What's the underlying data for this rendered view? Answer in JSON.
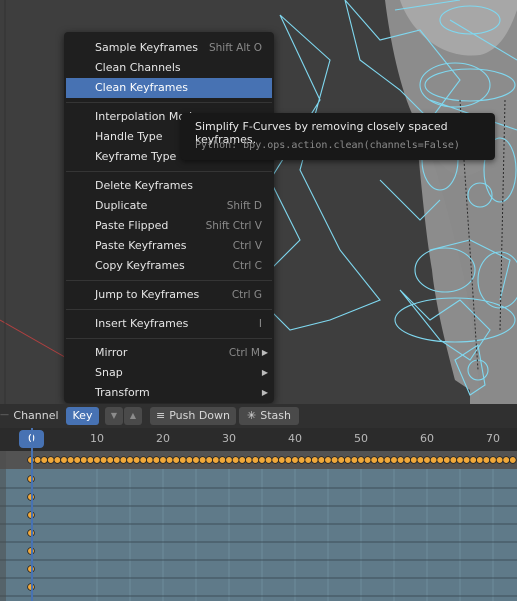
{
  "menu": {
    "items": [
      {
        "label": "Sample Keyframes",
        "shortcut": "Shift Alt O"
      },
      {
        "label": "Clean Channels",
        "shortcut": ""
      },
      {
        "label": "Clean Keyframes",
        "shortcut": "",
        "highlighted": true
      },
      {
        "label": "Interpolation Mod",
        "shortcut": ""
      },
      {
        "label": "Handle Type",
        "shortcut": ""
      },
      {
        "label": "Keyframe Type",
        "shortcut": ""
      },
      {
        "label": "Delete Keyframes",
        "shortcut": ""
      },
      {
        "label": "Duplicate",
        "shortcut": "Shift D"
      },
      {
        "label": "Paste Flipped",
        "shortcut": "Shift Ctrl V"
      },
      {
        "label": "Paste Keyframes",
        "shortcut": "Ctrl V"
      },
      {
        "label": "Copy Keyframes",
        "shortcut": "Ctrl C"
      },
      {
        "label": "Jump to Keyframes",
        "shortcut": "Ctrl G"
      },
      {
        "label": "Insert Keyframes",
        "shortcut": "I"
      },
      {
        "label": "Mirror",
        "shortcut": "Ctrl M",
        "submenu": true
      },
      {
        "label": "Snap",
        "shortcut": "",
        "submenu": true
      },
      {
        "label": "Transform",
        "shortcut": "",
        "submenu": true
      }
    ]
  },
  "tooltip": {
    "description": "Simplify F-Curves by removing closely spaced keyframes.",
    "python": "Python: bpy.ops.action.clean(channels=False)"
  },
  "header": {
    "channel_label": "Channel",
    "key_label": "Key",
    "push_down_label": "Push Down",
    "stash_label": "Stash"
  },
  "timeline": {
    "current_frame": "0",
    "ticks": [
      "10",
      "20",
      "30",
      "40",
      "50",
      "60",
      "70"
    ]
  },
  "colors": {
    "accent": "#4772b3",
    "keyframe": "#f0a83a",
    "bone_wire": "#7fd8f0"
  },
  "icons": {
    "arrow_down": "triangle-down",
    "arrow_up": "triangle-up",
    "push_down": "push-down-icon",
    "stash": "stash-icon",
    "submenu": "chevron-right-icon"
  }
}
